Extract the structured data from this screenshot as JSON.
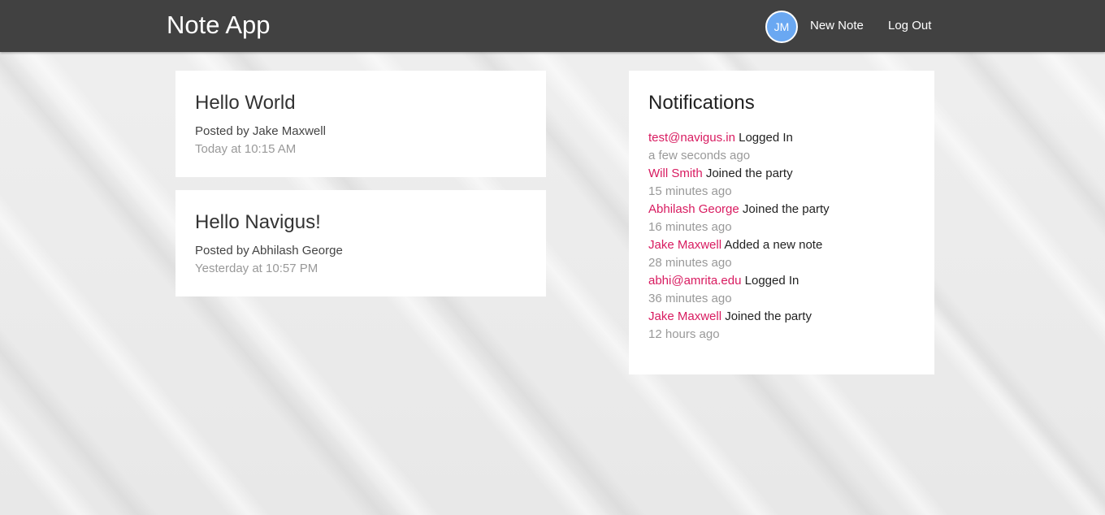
{
  "navbar": {
    "brand": "Note App",
    "avatar_initials": "JM",
    "new_note_label": "New Note",
    "logout_label": "Log Out"
  },
  "notes": [
    {
      "title": "Hello World",
      "author": "Posted by Jake Maxwell",
      "time": "Today at 10:15 AM"
    },
    {
      "title": "Hello Navigus!",
      "author": "Posted by Abhilash George",
      "time": "Yesterday at 10:57 PM"
    }
  ],
  "notifications": {
    "title": "Notifications",
    "items": [
      {
        "user": "test@navigus.in",
        "action": "Logged In",
        "time": "a few seconds ago"
      },
      {
        "user": "Will Smith",
        "action": "Joined the party",
        "time": "15 minutes ago"
      },
      {
        "user": "Abhilash George",
        "action": "Joined the party",
        "time": "16 minutes ago"
      },
      {
        "user": "Jake Maxwell",
        "action": "Added a new note",
        "time": "28 minutes ago"
      },
      {
        "user": "abhi@amrita.edu",
        "action": "Logged In",
        "time": "36 minutes ago"
      },
      {
        "user": "Jake Maxwell",
        "action": "Joined the party",
        "time": "12 hours ago"
      }
    ]
  },
  "colors": {
    "navbar_bg": "#414141",
    "accent_link": "#d81b60",
    "avatar_bg": "#6aa8f2",
    "muted_text": "#999999"
  }
}
